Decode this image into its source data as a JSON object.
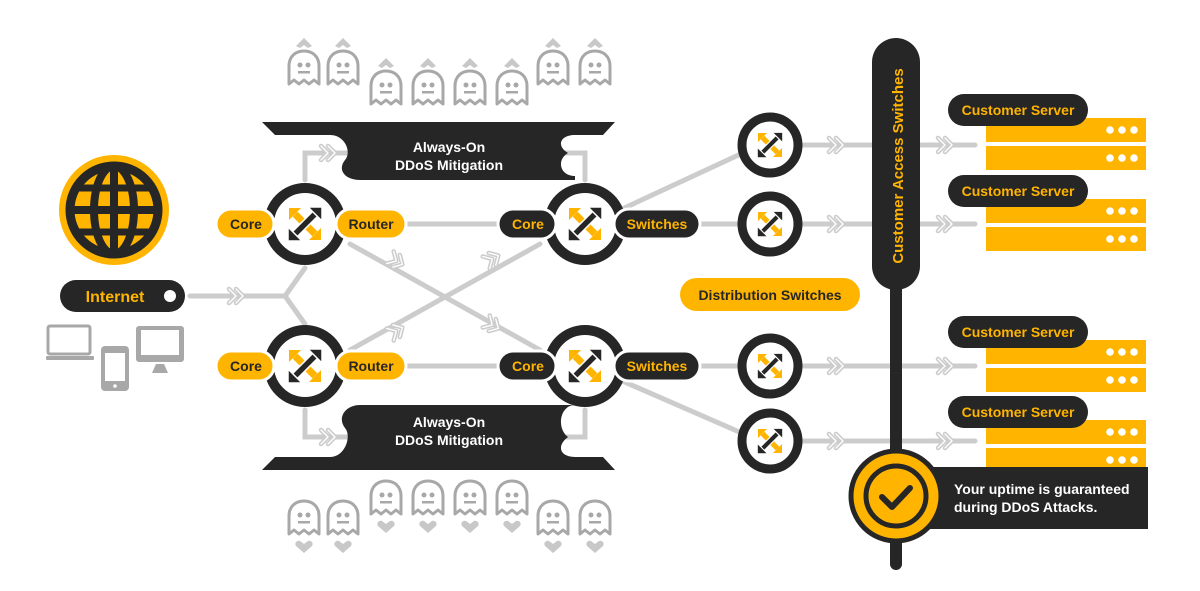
{
  "colors": {
    "accent": "#FFB400",
    "dark": "#262626",
    "link": "#cccccc",
    "ghost": "#a8a8a8",
    "heart": "#c8c8c8",
    "white": "#ffffff"
  },
  "internet": {
    "label": "Internet",
    "globe_icon": "globe-icon",
    "devices": [
      "laptop-icon",
      "phone-icon",
      "monitor-icon"
    ]
  },
  "core_routers": [
    {
      "left": "Core",
      "right": "Router"
    },
    {
      "left": "Core",
      "right": "Router"
    }
  ],
  "core_switches": [
    {
      "left": "Core",
      "right": "Switches"
    },
    {
      "left": "Core",
      "right": "Switches"
    }
  ],
  "mitigation": [
    {
      "line1": "Always-On",
      "line2": "DDoS Mitigation"
    },
    {
      "line1": "Always-On",
      "line2": "DDoS Mitigation"
    }
  ],
  "distribution": {
    "label": "Distribution Switches",
    "count": 4
  },
  "access_switches": {
    "label": "Customer Access Switches"
  },
  "customer_servers": [
    {
      "label": "Customer Server"
    },
    {
      "label": "Customer Server"
    },
    {
      "label": "Customer Server"
    },
    {
      "label": "Customer Server"
    }
  ],
  "uptime": {
    "line1": "Your uptime is guaranteed",
    "line2": "during DDoS Attacks.",
    "icon": "checkmark-icon"
  },
  "attackers": {
    "top": {
      "count": 8,
      "icon": "ghost-icon",
      "marker": "arrow-up"
    },
    "bottom": {
      "count": 8,
      "icon": "ghost-icon",
      "marker": "heart"
    }
  }
}
